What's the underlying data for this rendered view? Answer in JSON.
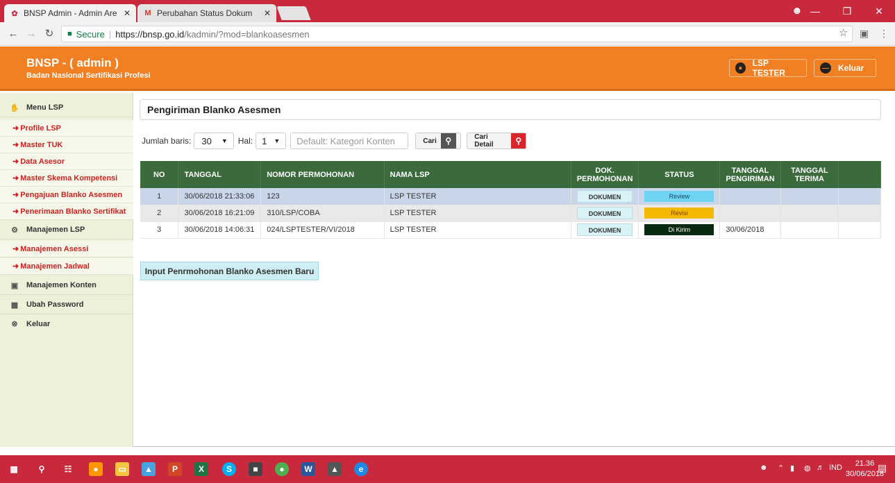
{
  "browser": {
    "tabs": [
      {
        "title": "BNSP Admin - Admin Are",
        "favicon": "bnsp-favicon"
      },
      {
        "title": "Perubahan Status Dokum",
        "favicon": "gmail-favicon"
      }
    ],
    "secure_label": "Secure",
    "url_host": "https://bnsp.go.id",
    "url_path": "/kadmin/?mod=blankoasesmen",
    "colors": {
      "chrome_red": "#c9293d"
    }
  },
  "header": {
    "title": "BNSP - ( admin )",
    "subtitle": "Badan Nasional Sertifikasi Profesi",
    "user_label": "LSP TESTER",
    "logout_label": "Keluar",
    "colors": {
      "accent": "#f08023"
    }
  },
  "sidebar": {
    "items": [
      {
        "label": "Menu LSP",
        "type": "main",
        "icon": "handshake-icon"
      },
      {
        "label": "Profile LSP",
        "type": "sub"
      },
      {
        "label": "Master TUK",
        "type": "sub"
      },
      {
        "label": "Data Asesor",
        "type": "sub"
      },
      {
        "label": "Master Skema Kompetensi",
        "type": "sub"
      },
      {
        "label": "Pengajuan Blanko Asesmen",
        "type": "sub"
      },
      {
        "label": "Penerimaan Blanko Sertifikat",
        "type": "sub"
      },
      {
        "label": "Manajemen LSP",
        "type": "main",
        "icon": "gear-icon"
      },
      {
        "label": "Manajemen Asessi",
        "type": "sub"
      },
      {
        "label": "Manajemen Jadwal",
        "type": "sub"
      },
      {
        "label": "Manajemen Konten",
        "type": "main",
        "icon": "content-icon"
      },
      {
        "label": "Ubah Password",
        "type": "main",
        "icon": "lock-icon"
      },
      {
        "label": "Keluar",
        "type": "main",
        "icon": "close-circle-icon"
      }
    ]
  },
  "main": {
    "page_title": "Pengiriman Blanko Asesmen",
    "filters": {
      "rows_label": "Jumlah baris:",
      "rows_value": "30",
      "page_label": "Hal:",
      "page_value": "1",
      "search_placeholder": "Default: Kategori Konten",
      "search_button": "Cari",
      "detail_button": "Cari Detail"
    },
    "table": {
      "headers": [
        "NO",
        "TANGGAL",
        "NOMOR PERMOHONAN",
        "NAMA LSP",
        "DOK. PERMOHONAN",
        "STATUS",
        "TANGGAL PENGIRIMAN",
        "TANGGAL TERIMA",
        ""
      ],
      "rows": [
        {
          "no": "1",
          "tanggal": "30/06/2018 21:33:06",
          "nomor": "123",
          "lsp": "LSP TESTER",
          "dok": "DOKUMEN",
          "status": "Review",
          "kirim": "",
          "terima": ""
        },
        {
          "no": "2",
          "tanggal": "30/06/2018 16:21:09",
          "nomor": "310/LSP/COBA",
          "lsp": "LSP TESTER",
          "dok": "DOKUMEN",
          "status": "Revisi",
          "kirim": "",
          "terima": ""
        },
        {
          "no": "3",
          "tanggal": "30/06/2018 14:06:31",
          "nomor": "024/LSPTESTER/VI/2018",
          "lsp": "LSP TESTER",
          "dok": "DOKUMEN",
          "status": "Di Kirim",
          "kirim": "30/06/2018",
          "terima": ""
        }
      ]
    },
    "new_button": "Input Penrmohonan Blanko Asesmen Baru"
  },
  "taskbar": {
    "language": "IND",
    "time": "21.36",
    "date": "30/06/2018"
  }
}
